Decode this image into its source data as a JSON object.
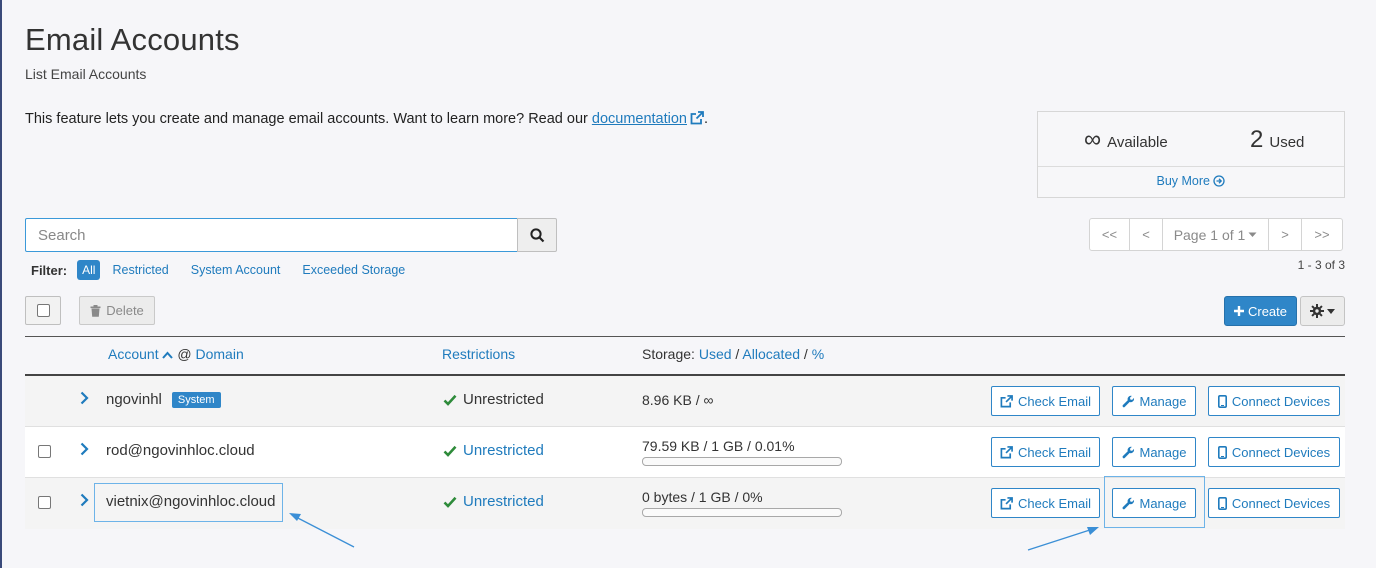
{
  "header": {
    "title": "Email Accounts",
    "subtitle": "List Email Accounts",
    "intro_text": "This feature lets you create and manage email accounts. Want to learn more? Read our ",
    "intro_link": "documentation",
    "intro_end": "."
  },
  "stats": {
    "available_value": "∞",
    "available_label": "Available",
    "used_value": "2",
    "used_label": "Used",
    "buy_more": "Buy More"
  },
  "search": {
    "placeholder": "Search",
    "value": ""
  },
  "filter": {
    "label": "Filter:",
    "options": [
      "All",
      "Restricted",
      "System Account",
      "Exceeded Storage"
    ],
    "active": "All"
  },
  "pagination": {
    "first": "<<",
    "prev": "<",
    "page_label": "Page 1 of 1",
    "next": ">",
    "last": ">>",
    "range": "1 - 3 of 3"
  },
  "toolbar": {
    "delete_label": "Delete",
    "create_label": "Create"
  },
  "table": {
    "col_account": "Account",
    "col_at": "@",
    "col_domain": "Domain",
    "col_restrictions": "Restrictions",
    "col_storage_prefix": "Storage:",
    "col_storage_used": "Used",
    "col_storage_allocated": "Allocated",
    "col_storage_percent": "%",
    "rows": [
      {
        "account": "ngovinhl",
        "badge": "System",
        "restriction": "Unrestricted",
        "storage": "8.96 KB / ∞",
        "usage_fraction": null
      },
      {
        "account": "rod@ngovinhloc.cloud",
        "badge": "",
        "restriction": "Unrestricted",
        "storage": "79.59 KB / 1 GB / 0.01%",
        "usage_fraction": 0.0001
      },
      {
        "account": "vietnix@ngovinhloc.cloud",
        "badge": "",
        "restriction": "Unrestricted",
        "storage": "0 bytes / 1 GB / 0%",
        "usage_fraction": 0
      }
    ],
    "actions": {
      "check_email": "Check Email",
      "manage": "Manage",
      "connect_devices": "Connect Devices"
    }
  },
  "colors": {
    "accent": "#2f86c8",
    "link": "#1f7bbd",
    "success": "#2e8b3a",
    "highlight": "#6db3e8"
  }
}
